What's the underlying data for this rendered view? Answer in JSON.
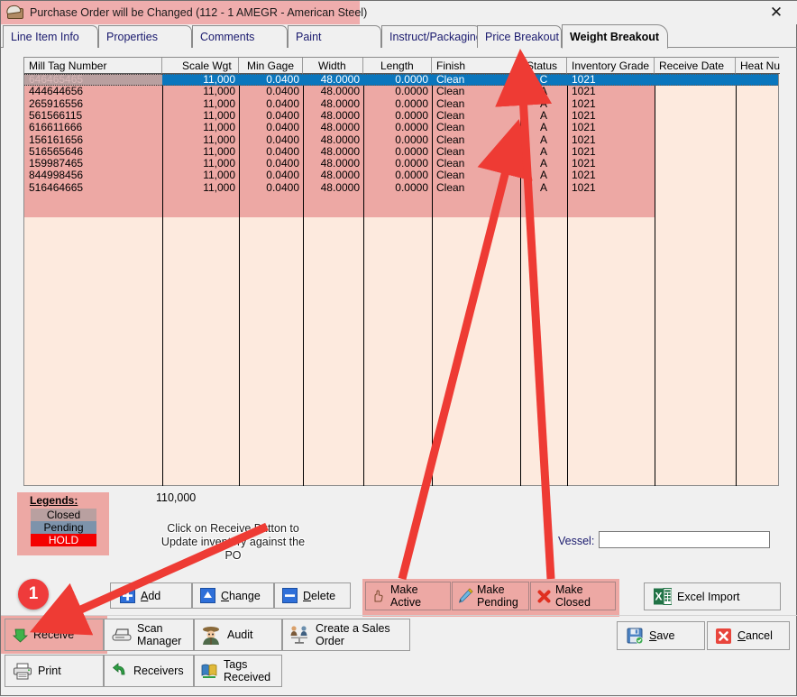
{
  "window": {
    "title": "Purchase Order will be Changed  (112 - 1  AMEGR - American Steel)",
    "icon": "package-box-icon",
    "close_label": "✕",
    "title_bar_color": "#efadad"
  },
  "tabs": [
    {
      "label": "Line Item Info",
      "active": false
    },
    {
      "label": "Properties",
      "active": false
    },
    {
      "label": "Comments",
      "active": false
    },
    {
      "label": "Paint",
      "active": false
    },
    {
      "label": "Instruct/Packaging",
      "active": false
    },
    {
      "label": "Price Breakout",
      "active": false
    },
    {
      "label": "Weight Breakout",
      "active": true
    }
  ],
  "grid": {
    "columns": [
      {
        "label": "Mill Tag Number",
        "align": "l"
      },
      {
        "label": "Scale Wgt",
        "align": "r"
      },
      {
        "label": "Min Gage",
        "align": "r"
      },
      {
        "label": "Width",
        "align": "r"
      },
      {
        "label": "Length",
        "align": "r"
      },
      {
        "label": "Finish",
        "align": "l"
      },
      {
        "label": "Status",
        "align": "c"
      },
      {
        "label": "Inventory Grade",
        "align": "l"
      },
      {
        "label": "Receive Date",
        "align": "l"
      },
      {
        "label": "Heat Number",
        "align": "l"
      }
    ],
    "rows": [
      {
        "mill_tag": "646465465",
        "scale_wgt": "11,000",
        "min_gage": "0.0400",
        "width": "48.0000",
        "length": "0.0000",
        "finish": "Clean",
        "status": "C",
        "inventory_grade": "1021",
        "receive_date": "",
        "heat_number": "",
        "selected": true
      },
      {
        "mill_tag": "444644656",
        "scale_wgt": "11,000",
        "min_gage": "0.0400",
        "width": "48.0000",
        "length": "0.0000",
        "finish": "Clean",
        "status": "A",
        "inventory_grade": "1021",
        "receive_date": "",
        "heat_number": "",
        "selected": false
      },
      {
        "mill_tag": "265916556",
        "scale_wgt": "11,000",
        "min_gage": "0.0400",
        "width": "48.0000",
        "length": "0.0000",
        "finish": "Clean",
        "status": "A",
        "inventory_grade": "1021",
        "receive_date": "",
        "heat_number": "",
        "selected": false
      },
      {
        "mill_tag": "561566115",
        "scale_wgt": "11,000",
        "min_gage": "0.0400",
        "width": "48.0000",
        "length": "0.0000",
        "finish": "Clean",
        "status": "A",
        "inventory_grade": "1021",
        "receive_date": "",
        "heat_number": "",
        "selected": false
      },
      {
        "mill_tag": "616611666",
        "scale_wgt": "11,000",
        "min_gage": "0.0400",
        "width": "48.0000",
        "length": "0.0000",
        "finish": "Clean",
        "status": "A",
        "inventory_grade": "1021",
        "receive_date": "",
        "heat_number": "",
        "selected": false
      },
      {
        "mill_tag": "156161656",
        "scale_wgt": "11,000",
        "min_gage": "0.0400",
        "width": "48.0000",
        "length": "0.0000",
        "finish": "Clean",
        "status": "A",
        "inventory_grade": "1021",
        "receive_date": "",
        "heat_number": "",
        "selected": false
      },
      {
        "mill_tag": "516565646",
        "scale_wgt": "11,000",
        "min_gage": "0.0400",
        "width": "48.0000",
        "length": "0.0000",
        "finish": "Clean",
        "status": "A",
        "inventory_grade": "1021",
        "receive_date": "",
        "heat_number": "",
        "selected": false
      },
      {
        "mill_tag": "159987465",
        "scale_wgt": "11,000",
        "min_gage": "0.0400",
        "width": "48.0000",
        "length": "0.0000",
        "finish": "Clean",
        "status": "A",
        "inventory_grade": "1021",
        "receive_date": "",
        "heat_number": "",
        "selected": false
      },
      {
        "mill_tag": "844998456",
        "scale_wgt": "11,000",
        "min_gage": "0.0400",
        "width": "48.0000",
        "length": "0.0000",
        "finish": "Clean",
        "status": "A",
        "inventory_grade": "1021",
        "receive_date": "",
        "heat_number": "",
        "selected": false
      },
      {
        "mill_tag": "516464665",
        "scale_wgt": "11,000",
        "min_gage": "0.0400",
        "width": "48.0000",
        "length": "0.0000",
        "finish": "Clean",
        "status": "A",
        "inventory_grade": "1021",
        "receive_date": "",
        "heat_number": "",
        "selected": false
      }
    ],
    "selection_color": "#0a76bd",
    "row_color": "#eda8a4",
    "empty_color": "#fdeade"
  },
  "totals": {
    "scale_wgt_total": "110,000"
  },
  "legends": {
    "title": "Legends:",
    "items": [
      {
        "label": "Closed",
        "bg": "#b9a0a0",
        "fg": "#000000"
      },
      {
        "label": "Pending",
        "bg": "#7d93ab",
        "fg": "#000000"
      },
      {
        "label": "HOLD",
        "bg": "#f40000",
        "fg": "#ffffff"
      }
    ]
  },
  "vessel": {
    "label": "Vessel:",
    "value": "",
    "placeholder": ""
  },
  "annotations": {
    "callout_text": "Click on Receive Button to Update inventory against the PO",
    "step_badge": "1",
    "arrow_color": "#ee3b34"
  },
  "toolbar_row": [
    {
      "label": "Add",
      "icon": "plus-square-icon",
      "accesskey": "A"
    },
    {
      "label": "Change",
      "icon": "up-triangle-icon",
      "accesskey": "C"
    },
    {
      "label": "Delete",
      "icon": "minus-square-icon",
      "accesskey": "D"
    }
  ],
  "status_buttons": [
    {
      "label": "Make Active",
      "icon": "pointing-hand-icon"
    },
    {
      "label": "Make\nPending",
      "icon": "pencil-icon"
    },
    {
      "label": "Make\nClosed",
      "icon": "red-x-icon"
    }
  ],
  "excel_button": {
    "label": "Excel Import",
    "icon": "excel-icon"
  },
  "action_row_1": [
    {
      "label": "Receive",
      "icon": "green-arrow-icon",
      "highlighted": true
    },
    {
      "label": "Scan\nManager",
      "icon": "scanner-icon",
      "highlighted": false
    },
    {
      "label": "Audit",
      "icon": "detective-icon",
      "highlighted": false
    },
    {
      "label": "Create a Sales\nOrder",
      "icon": "sales-order-icon",
      "highlighted": false
    }
  ],
  "action_row_2": [
    {
      "label": "Print",
      "icon": "printer-icon"
    },
    {
      "label": "Receivers",
      "icon": "green-curved-arrow-icon"
    },
    {
      "label": "Tags\nReceived",
      "icon": "books-icon"
    }
  ],
  "footer_buttons": [
    {
      "label": "Save",
      "icon": "floppy-disk-icon",
      "accesskey": "S"
    },
    {
      "label": "Cancel",
      "icon": "red-x-icon",
      "accesskey": "C"
    }
  ]
}
